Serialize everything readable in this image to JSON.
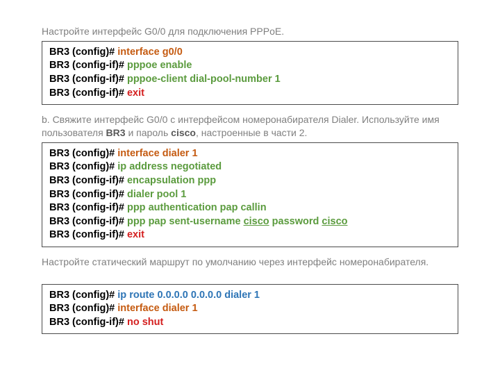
{
  "desc1": "Настройте интерфейс G0/0 для подключения PPPoE.",
  "box1": {
    "l1p": "BR3 (config)# ",
    "l1c": "interface g0/0",
    "l2p": "BR3 (config-if)# ",
    "l2c": "pppoe enable",
    "l3p": "BR3 (config-if)# ",
    "l3c": "pppoe-client dial-pool-number 1",
    "l4p": "BR3 (config-if)# ",
    "l4c": "exit"
  },
  "desc2a": "b. Свяжите интерфейс G0/0 с интерфейсом номеронабирателя Dialer. Используйте имя пользователя ",
  "desc2b": "BR3",
  "desc2c": " и пароль ",
  "desc2d": "cisco",
  "desc2e": ", настроенные в части 2.",
  "box2": {
    "l1p": "BR3 (config)# ",
    "l1c": "interface dialer 1",
    "l2p": "BR3 (config)# ",
    "l2c": "ip address negotiated",
    "l3p": "BR3 (config-if)# ",
    "l3c": "encapsulation ppp",
    "l4p": "BR3 (config-if)# ",
    "l4c": "dialer pool 1",
    "l5p": "BR3 (config-if)# ",
    "l5c": "ppp authentication pap callin",
    "l6p": "BR3 (config-if)# ",
    "l6a": "ppp pap sent-username ",
    "l6b": "cisco",
    "l6c": " password ",
    "l6d": "cisco",
    "l7p": "BR3 (config-if)# ",
    "l7c": "exit"
  },
  "desc3": "Настройте статический маршрут по умолчанию через интерфейс номеронабирателя.",
  "box3": {
    "l1p": "BR3 (config)# ",
    "l1c": "ip route 0.0.0.0 0.0.0.0 dialer 1",
    "l2p": "BR3 (config)# ",
    "l2c": "interface dialer 1",
    "l3p": "BR3 (config-if)# ",
    "l3c": "no shut"
  }
}
